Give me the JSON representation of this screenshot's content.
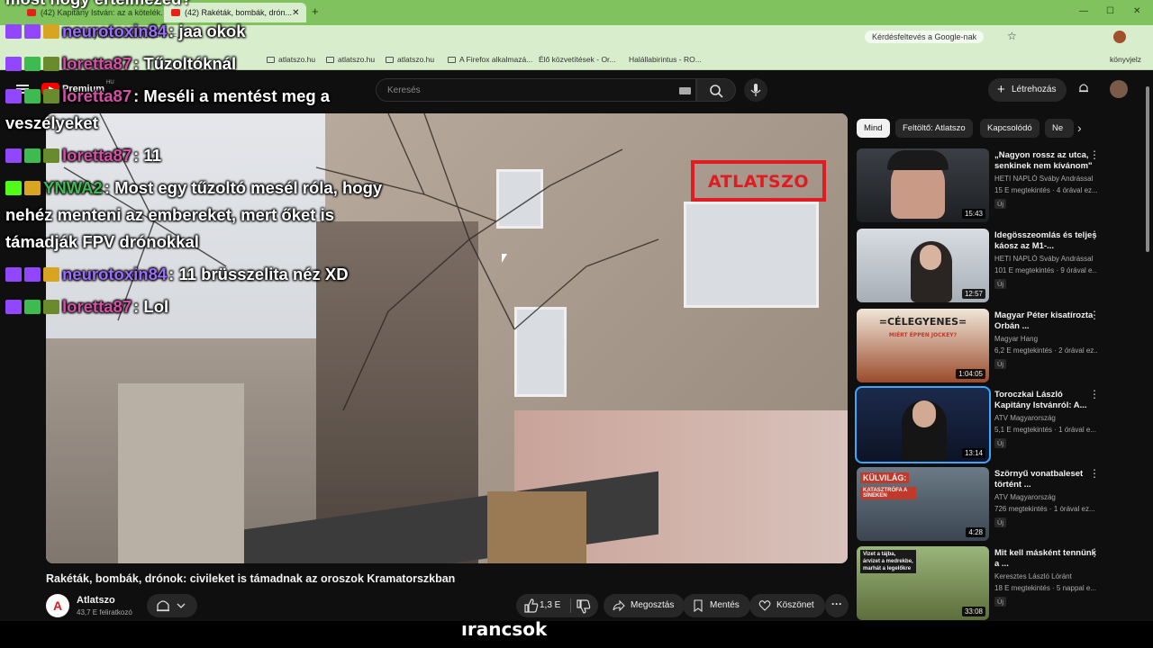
{
  "browser": {
    "tabs": [
      {
        "label": "(42) Kapitány István: az a kötelék..."
      },
      {
        "label": "(42) Rakéták, bombák, drón..."
      }
    ],
    "url": "youtube.com/watch?v=...",
    "addr_action": "Kérdésfeltevés a Google-nak",
    "bookmarks": [
      "atlatszo.hu",
      "atlatszo.hu",
      "atlatszo.hu",
      "A Firefox alkalmazá...",
      "Élő közvetítések - Or...",
      "Halállabirintus - RO...",
      "könyvjelz"
    ]
  },
  "yt": {
    "premium": "Premium",
    "country": "HU",
    "search_placeholder": "Keresés",
    "create_label": "Létrehozás"
  },
  "video": {
    "watermark": "ATLATSZO",
    "title": "Rakéták, bombák, drónok: civileket is támadnak az oroszok Kramatorszkban",
    "channel": "Atlatszo",
    "subscribers": "43,7 E feliratkozó",
    "likes": "1,3 E",
    "share": "Megosztás",
    "save": "Mentés",
    "thanks": "Köszönet",
    "more": "···"
  },
  "chips": [
    "Mind",
    "Feltöltő: Atlatszo",
    "Kapcsolódó",
    "Ne"
  ],
  "recommendations": [
    {
      "title": "„Nagyon rossz az utca, senkinek nem kívánom\"",
      "channel": "HETI NAPLÓ Sváby Andrással",
      "meta": "15 E megtekintés · 4 órával ez...",
      "badge": "Új",
      "duration": "15:43"
    },
    {
      "title": "Idegösszeomlás és teljes káosz az M1-...",
      "channel": "HETI NAPLÓ Sváby Andrással",
      "meta": "101 E megtekintés · 9 órával e...",
      "badge": "Új",
      "duration": "12:57"
    },
    {
      "title": "Magyar Péter kisatírozta Orbán ...",
      "channel": "Magyar Hang",
      "meta": "6,2 E megtekintés · 2 órával ez...",
      "badge": "Új",
      "duration": "1:04:05",
      "thumb_text": "=CÉLEGYENES=",
      "thumb_sub": "MIÉRT ÉPPEN JOCKEY?"
    },
    {
      "title": "Toroczkai László Kapitány Istvánról: A...",
      "channel": "ATV Magyarország",
      "meta": "5,1 E megtekintés · 1 órával e...",
      "badge": "Új",
      "duration": "13:14"
    },
    {
      "title": "Szörnyű vonatbaleset történt ...",
      "channel": "ATV Magyarország",
      "meta": "726 megtekintés · 1 órával ez...",
      "badge": "Új",
      "duration": "4:28",
      "thumb_text": "KÜLVILÁG:",
      "thumb_sub": "KATASZTRÓFA A SÍNEKEN"
    },
    {
      "title": "Mit kell másként tennünk a ...",
      "channel": "Keresztes László Lóránt",
      "meta": "18 E megtekintés · 5 nappal e...",
      "badge": "Új",
      "duration": "33:08",
      "thumb_text": "Vizet a tájba, árvizet a medrekbe, marhát a legelőkre"
    }
  ],
  "chat": {
    "top_partial": "most hogy értelmezed?",
    "messages": [
      {
        "user": "neurotoxin84",
        "text": ": jaa okok",
        "color": "#9b6cff"
      },
      {
        "user": "loretta87",
        "text": ": Tűzoltóknál",
        "color": "#d44fa6"
      },
      {
        "user": "loretta87",
        "text": ": Meséli a mentést meg a veszélyeket",
        "color": "#d44fa6"
      },
      {
        "user": "loretta87",
        "text": ": 11",
        "color": "#d44fa6"
      },
      {
        "user": "YNWA2",
        "text": ": Most egy tűzoltó mesél róla, hogy nehéz menteni az embereket, mert őket is támadják FPV drónokkal",
        "color": "#3dbb51"
      },
      {
        "user": "neurotoxin84",
        "text": ": 11 brüsszelita néz XD",
        "color": "#9b6cff"
      },
      {
        "user": "loretta87",
        "text": ": Lol",
        "color": "#d44fa6"
      }
    ]
  },
  "overlay_bottom": "ırancsok"
}
